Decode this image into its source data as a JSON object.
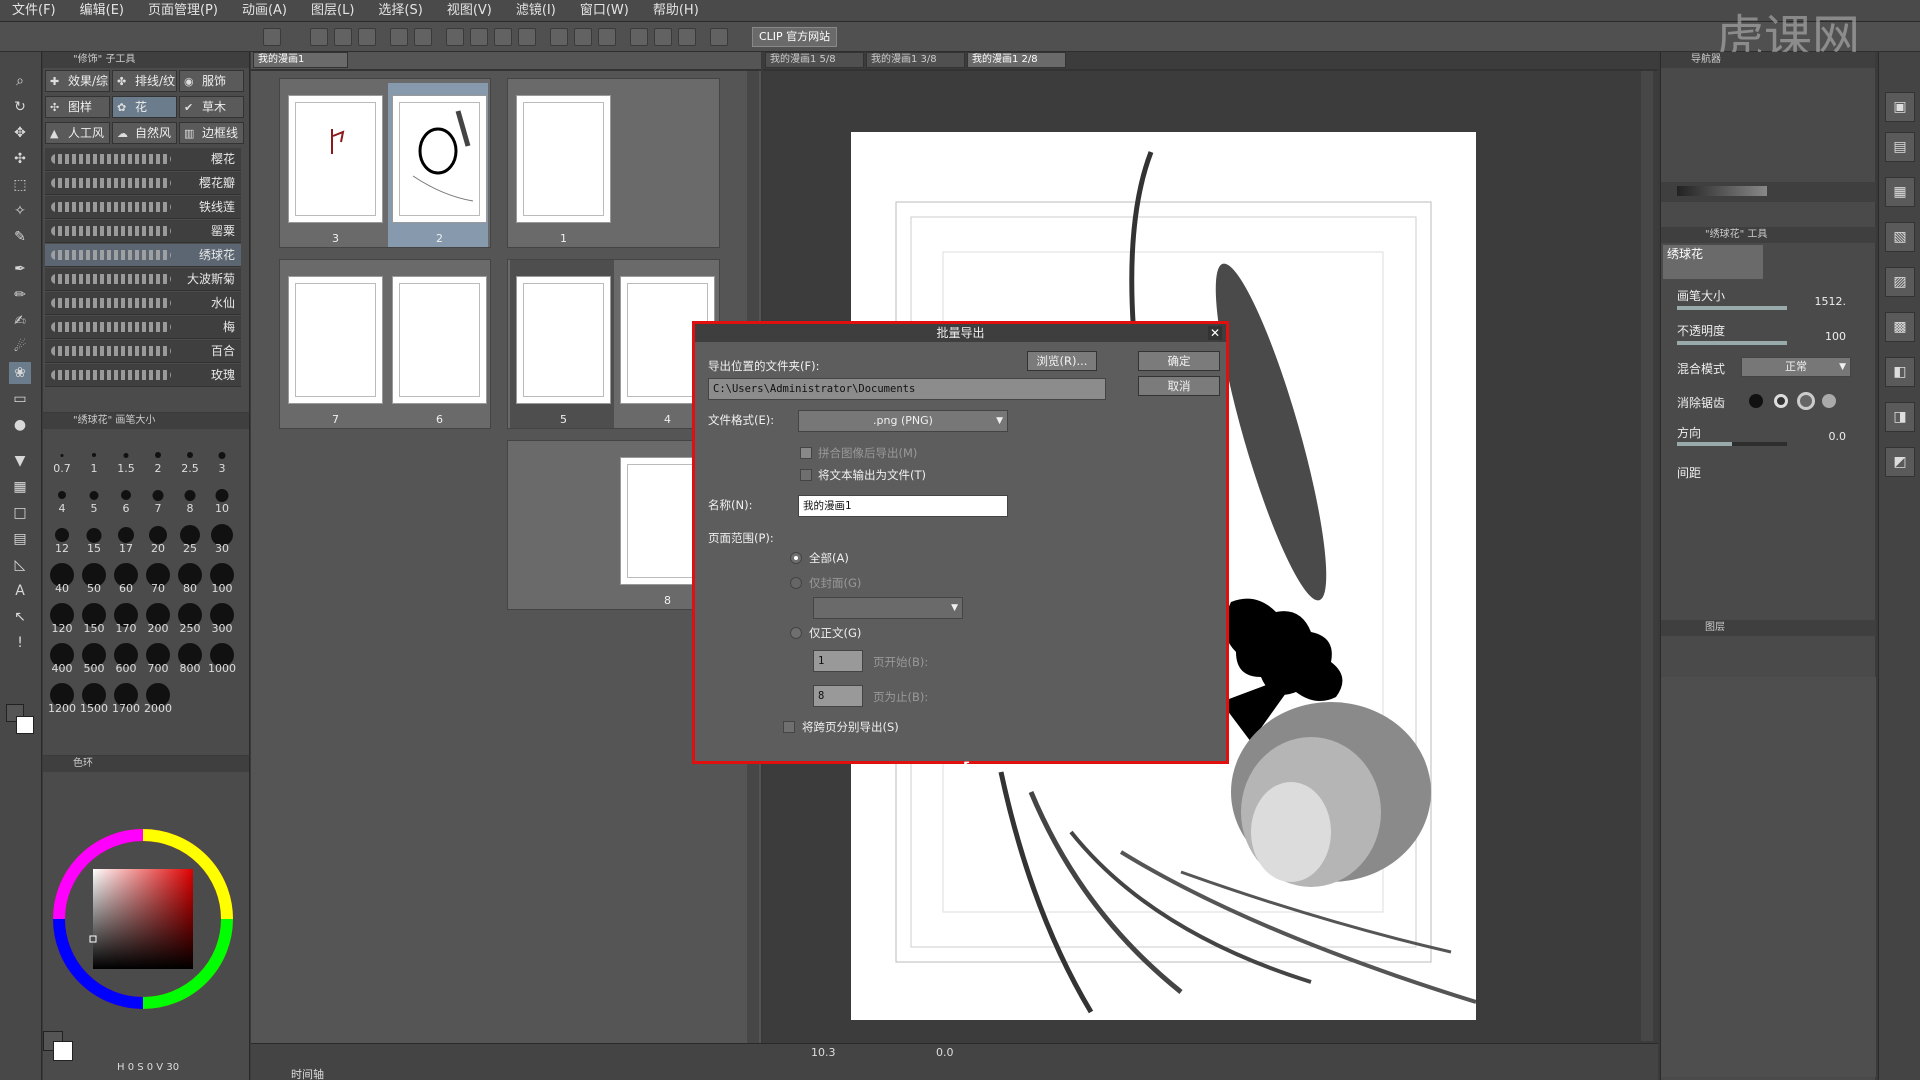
{
  "menu": [
    "文件(F)",
    "编辑(E)",
    "页面管理(P)",
    "动画(A)",
    "图层(L)",
    "选择(S)",
    "视图(V)",
    "滤镜(I)",
    "窗口(W)",
    "帮助(H)"
  ],
  "toolbar": {
    "clip_site": "CLIP 官方网站",
    "logo_text": "虎课网"
  },
  "subtool": {
    "header": "\"修饰\" 子工具",
    "tabs": [
      "效果/综",
      "排线/纹",
      "服饰",
      "图样",
      "花",
      "草木",
      "人工风",
      "自然风",
      "边框线"
    ],
    "brushes": [
      "樱花",
      "樱花瓣",
      "铁线莲",
      "罂粟",
      "绣球花",
      "大波斯菊",
      "水仙",
      "梅",
      "百合",
      "玫瑰"
    ]
  },
  "brushsize": {
    "header": "\"绣球花\" 画笔大小",
    "sizes": [
      "0.7",
      "1",
      "1.5",
      "2",
      "2.5",
      "3",
      "4",
      "5",
      "6",
      "7",
      "8",
      "10",
      "12",
      "15",
      "17",
      "20",
      "25",
      "30",
      "40",
      "50",
      "60",
      "70",
      "80",
      "100",
      "120",
      "150",
      "170",
      "200",
      "250",
      "300",
      "400",
      "500",
      "600",
      "700",
      "800",
      "1000",
      "1200",
      "1500",
      "1700",
      "2000"
    ]
  },
  "color": {
    "header": "色环",
    "status": "H 0 S 0 V 30"
  },
  "pagemanager": {
    "tab": "我的漫画1",
    "pages": [
      "3",
      "2",
      "1",
      "7",
      "6",
      "5",
      "4",
      "8"
    ]
  },
  "canvas": {
    "tabs": [
      "我的漫画1 5/8",
      "我的漫画1 3/8",
      "我的漫画1 2/8"
    ],
    "zoom": "10.3",
    "rotate": "0.0"
  },
  "dialog": {
    "title": "批量导出",
    "folder_label": "导出位置的文件夹(F):",
    "browse": "浏览(R)...",
    "ok": "确定",
    "cancel": "取消",
    "path": "C:\\Users\\Administrator\\Documents",
    "format_label": "文件格式(E):",
    "format_value": ".png (PNG)",
    "merge_label": "拼合图像后导出(M)",
    "text_label": "将文本输出为文件(T)",
    "name_label": "名称(N):",
    "name_value": "我的漫画1",
    "range_label": "页面范围(P):",
    "all_label": "全部(A)",
    "cover_label": "仅封面(G)",
    "body_label": "仅正文(G)",
    "start_label": "页开始(B):",
    "start_value": "1",
    "end_label": "页为止(B):",
    "end_value": "8",
    "spread_label": "将跨页分别导出(S)"
  },
  "tooltprops": {
    "nav": "导航器",
    "header": "\"绣球花\" 工具",
    "brush_name": "绣球花",
    "size_label": "画笔大小",
    "size_value": "1512.",
    "opacity_label": "不透明度",
    "opacity_value": "100",
    "blend_label": "混合模式",
    "blend_value": "正常",
    "aa_label": "消除锯齿",
    "dir_label": "方向",
    "dir_value": "0.0",
    "spacing_label": "间距"
  },
  "layers": {
    "header": "图层"
  },
  "bottom": {
    "timeline": "时间轴"
  }
}
